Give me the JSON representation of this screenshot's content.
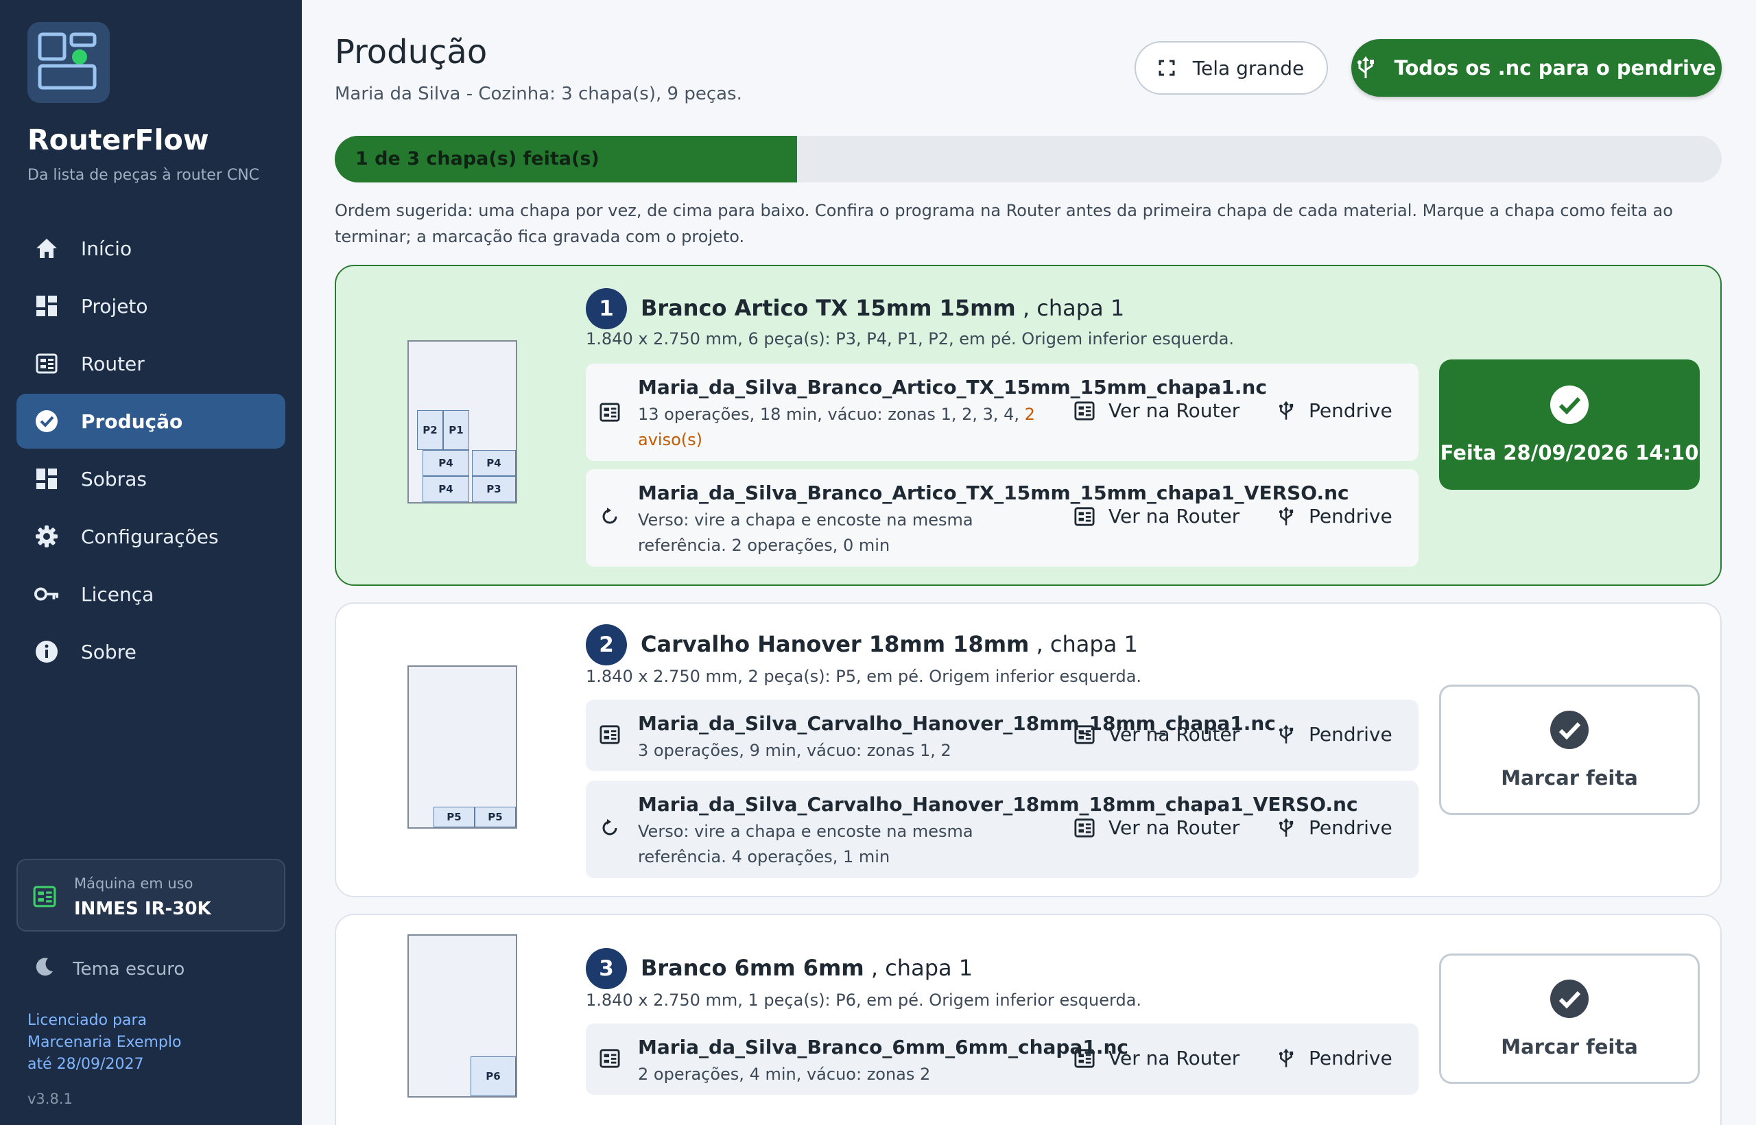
{
  "app": {
    "name": "RouterFlow",
    "tagline": "Da lista de peças à router CNC"
  },
  "sidebar": {
    "items": [
      {
        "label": "Início",
        "icon": "home-icon"
      },
      {
        "label": "Projeto",
        "icon": "dashboard-icon"
      },
      {
        "label": "Router",
        "icon": "router-icon"
      },
      {
        "label": "Produção",
        "icon": "check-circle-icon",
        "active": true
      },
      {
        "label": "Sobras",
        "icon": "dashboard-icon"
      },
      {
        "label": "Configurações",
        "icon": "gear-icon"
      },
      {
        "label": "Licença",
        "icon": "key-icon"
      },
      {
        "label": "Sobre",
        "icon": "info-icon"
      }
    ],
    "machine": {
      "label": "Máquina em uso",
      "name": "INMES IR-30K"
    },
    "theme_label": "Tema escuro",
    "license": {
      "line1": "Licenciado para",
      "line2": "Marcenaria Exemplo",
      "line3": "até 28/09/2027"
    },
    "version": "v3.8.1"
  },
  "header": {
    "title": "Produção",
    "subtitle": "Maria da Silva - Cozinha: 3 chapa(s), 9 peças.",
    "fullscreen_label": "Tela grande",
    "all_usb_label": "Todos os .nc para o pendrive"
  },
  "progress": {
    "text": "1 de 3 chapa(s) feita(s)",
    "done": 1,
    "total": 3
  },
  "hint": "Ordem sugerida: uma chapa por vez, de cima para baixo. Confira o programa na Router antes da primeira chapa de cada material. Marque a chapa como feita ao terminar; a marcação fica gravada com o projeto.",
  "colors": {
    "sidebar": "#1c2c44",
    "accent_green": "#25792f",
    "done_card": "#dcf3df",
    "number_badge": "#1c3a6b",
    "warning": "#c35a00"
  },
  "sheets": [
    {
      "number": "1",
      "material": "Branco Artico TX 15mm 15mm",
      "suffix": ", chapa 1",
      "info": "1.840 x 2.750 mm, 6 peça(s): P3, P4, P1, P2, em pé. Origem inferior esquerda.",
      "pieces": [
        "P2",
        "P1",
        "P4",
        "P4",
        "P4",
        "P3"
      ],
      "files": [
        {
          "name": "Maria_da_Silva_Branco_Artico_TX_15mm_15mm_chapa1.nc",
          "meta": "13 operações, 18 min, vácuo: zonas 1, 2, 3, 4, ",
          "warn": "2 aviso(s)",
          "router": "Ver na Router",
          "usb": "Pendrive"
        },
        {
          "name": "Maria_da_Silva_Branco_Artico_TX_15mm_15mm_chapa1_VERSO.nc",
          "meta": "Verso: vire a chapa e encoste na mesma referência. 2 operações, 0 min",
          "router": "Ver na Router",
          "usb": "Pendrive"
        }
      ],
      "status": "Feita 28/09/2026 14:10",
      "done": true
    },
    {
      "number": "2",
      "material": "Carvalho Hanover 18mm 18mm",
      "suffix": ", chapa 1",
      "info": "1.840 x 2.750 mm, 2 peça(s): P5, em pé. Origem inferior esquerda.",
      "pieces": [
        "P5",
        "P5"
      ],
      "files": [
        {
          "name": "Maria_da_Silva_Carvalho_Hanover_18mm_18mm_chapa1.nc",
          "meta": "3 operações, 9 min, vácuo: zonas 1, 2",
          "router": "Ver na Router",
          "usb": "Pendrive"
        },
        {
          "name": "Maria_da_Silva_Carvalho_Hanover_18mm_18mm_chapa1_VERSO.nc",
          "meta": "Verso: vire a chapa e encoste na mesma referência. 4 operações, 1 min",
          "router": "Ver na Router",
          "usb": "Pendrive"
        }
      ],
      "status": "Marcar feita",
      "done": false
    },
    {
      "number": "3",
      "material": "Branco 6mm 6mm",
      "suffix": ", chapa 1",
      "info": "1.840 x 2.750 mm, 1 peça(s): P6, em pé. Origem inferior esquerda.",
      "pieces": [
        "P6"
      ],
      "files": [
        {
          "name": "Maria_da_Silva_Branco_6mm_6mm_chapa1.nc",
          "meta": "2 operações, 4 min, vácuo: zonas 2",
          "router": "Ver na Router",
          "usb": "Pendrive"
        }
      ],
      "status": "Marcar feita",
      "done": false
    }
  ]
}
